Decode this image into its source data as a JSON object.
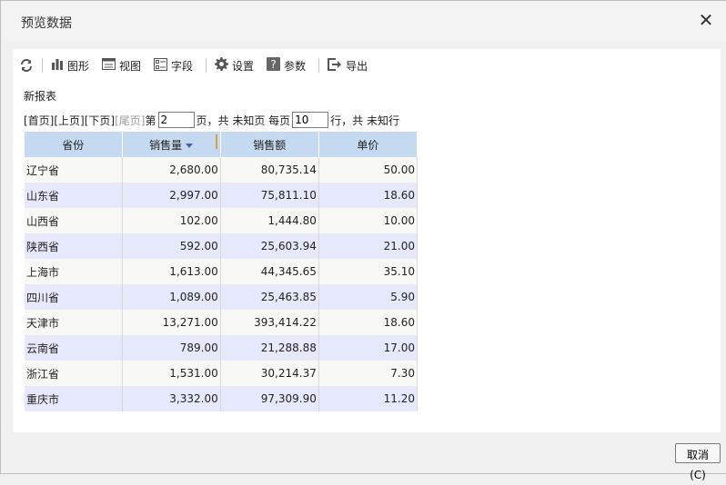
{
  "dialog": {
    "title": "预览数据",
    "close_symbol": "✕"
  },
  "toolbar": {
    "items": [
      {
        "label": "图形",
        "icon": "bar-chart-icon"
      },
      {
        "label": "视图",
        "icon": "view-icon"
      },
      {
        "label": "字段",
        "icon": "field-icon"
      },
      {
        "label": "设置",
        "icon": "gear-icon"
      },
      {
        "label": "参数",
        "icon": "question-icon"
      },
      {
        "label": "导出",
        "icon": "export-icon"
      }
    ],
    "refresh_icon": "refresh-icon"
  },
  "report": {
    "name": "新报表"
  },
  "pager": {
    "first": "[首页]",
    "prev": "[上页]",
    "next": "[下页]",
    "last": "[尾页]",
    "page_prefix": "第",
    "page_value": "2",
    "page_suffix": "页，共 未知页 每页",
    "per_page_value": "10",
    "rows_suffix": "行，共 未知行"
  },
  "table": {
    "headers": [
      "省份",
      "销售量",
      "销售额",
      "单价"
    ],
    "sorted_column": "销售量",
    "rows": [
      [
        "辽宁省",
        "2,680.00",
        "80,735.14",
        "50.00"
      ],
      [
        "山东省",
        "2,997.00",
        "75,811.10",
        "18.60"
      ],
      [
        "山西省",
        "102.00",
        "1,444.80",
        "10.00"
      ],
      [
        "陕西省",
        "592.00",
        "25,603.94",
        "21.00"
      ],
      [
        "上海市",
        "1,613.00",
        "44,345.65",
        "35.10"
      ],
      [
        "四川省",
        "1,089.00",
        "25,463.85",
        "5.90"
      ],
      [
        "天津市",
        "13,271.00",
        "393,414.22",
        "18.60"
      ],
      [
        "云南省",
        "789.00",
        "21,288.88",
        "17.00"
      ],
      [
        "浙江省",
        "1,531.00",
        "30,214.37",
        "7.30"
      ],
      [
        "重庆市",
        "3,332.00",
        "97,309.90",
        "11.20"
      ]
    ]
  },
  "footer": {
    "cancel_label": "取消(C)"
  },
  "colors": {
    "header_bg": "#c5d9f1",
    "row_alt_bg": "#e6e9fb",
    "row_bg": "#f8f8f5"
  }
}
